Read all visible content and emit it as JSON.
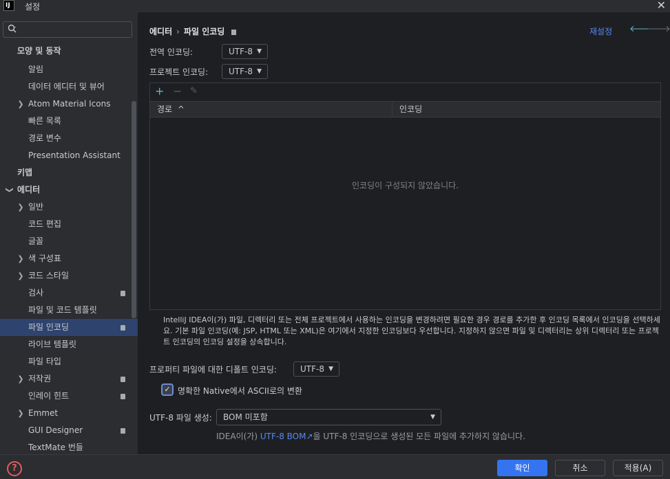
{
  "window": {
    "app_icon": "IJ",
    "title": "설정",
    "close": "✕"
  },
  "sidebar": {
    "search_placeholder": "",
    "items": [
      {
        "label": "모양 및 동작",
        "bold": true
      },
      {
        "label": "알림"
      },
      {
        "label": "데이터 에디터 및 뷰어"
      },
      {
        "label": "Atom Material Icons"
      },
      {
        "label": "빠른 목록"
      },
      {
        "label": "경로 변수"
      },
      {
        "label": "Presentation Assistant"
      },
      {
        "label": "키맵",
        "bold": true
      },
      {
        "label": "에디터",
        "bold": true
      },
      {
        "label": "일반"
      },
      {
        "label": "코드 편집"
      },
      {
        "label": "글꼴"
      },
      {
        "label": "색 구성표"
      },
      {
        "label": "코드 스타일"
      },
      {
        "label": "검사"
      },
      {
        "label": "파일 및 코드 템플릿"
      },
      {
        "label": "파일 인코딩"
      },
      {
        "label": "라이브 템플릿"
      },
      {
        "label": "파일 타입"
      },
      {
        "label": "저작권"
      },
      {
        "label": "인레이 힌트"
      },
      {
        "label": "Emmet"
      },
      {
        "label": "GUI Designer"
      },
      {
        "label": "TextMate 번들"
      }
    ]
  },
  "header": {
    "crumb_parent": "에디터",
    "crumb_sep": "›",
    "crumb_current": "파일 인코딩",
    "reset": "재설정",
    "back": "🡐",
    "forward": "🡒"
  },
  "global_encoding": {
    "label": "전역 인코딩:",
    "value": "UTF-8"
  },
  "project_encoding": {
    "label": "프로젝트 인코딩:",
    "value": "UTF-8"
  },
  "table": {
    "add": "+",
    "remove": "−",
    "edit": "✎",
    "col_path": "경로",
    "sort_icon": "^",
    "col_encoding": "인코딩",
    "empty": "인코딩이 구성되지 않았습니다."
  },
  "help_text": "IntelliJ IDEA이(가) 파일, 디렉터리 또는 전체 프로젝트에서 사용하는 인코딩을 변경하려면 필요한 경우 경로를 추가한 후 인코딩 목록에서 인코딩을 선택하세요. 기본 파일 인코딩(예: JSP, HTML 또는 XML)은 여기에서 지정한 인코딩보다 우선합니다. 지정하지 않으면 파일 및 디렉터리는 상위 디렉터리 또는 프로젝트 인코딩의 인코딩 설정을 상속합니다.",
  "properties_encoding": {
    "label": "프로퍼티 파일에 대한 디폴트 인코딩:",
    "value": "UTF-8"
  },
  "native_to_ascii": {
    "label": "명확한 Native에서 ASCII로의 변환",
    "checked": true,
    "check_glyph": "✓"
  },
  "bom": {
    "label": "UTF-8 파일 생성:",
    "value": "BOM 미포함"
  },
  "bom_note": {
    "prefix": "IDEA이(가) ",
    "link": "UTF-8 BOM",
    "ext_icon": "↗",
    "suffix": "을 UTF-8 인코딩으로 생성된 모든 파일에 추가하지 않습니다."
  },
  "footer": {
    "help": "?",
    "ok": "확인",
    "cancel": "취소",
    "apply": "적용(A)"
  },
  "colors": {
    "accent": "#3574f0",
    "selection": "#2e436e",
    "link": "#548af7",
    "help": "#e55b5b"
  }
}
